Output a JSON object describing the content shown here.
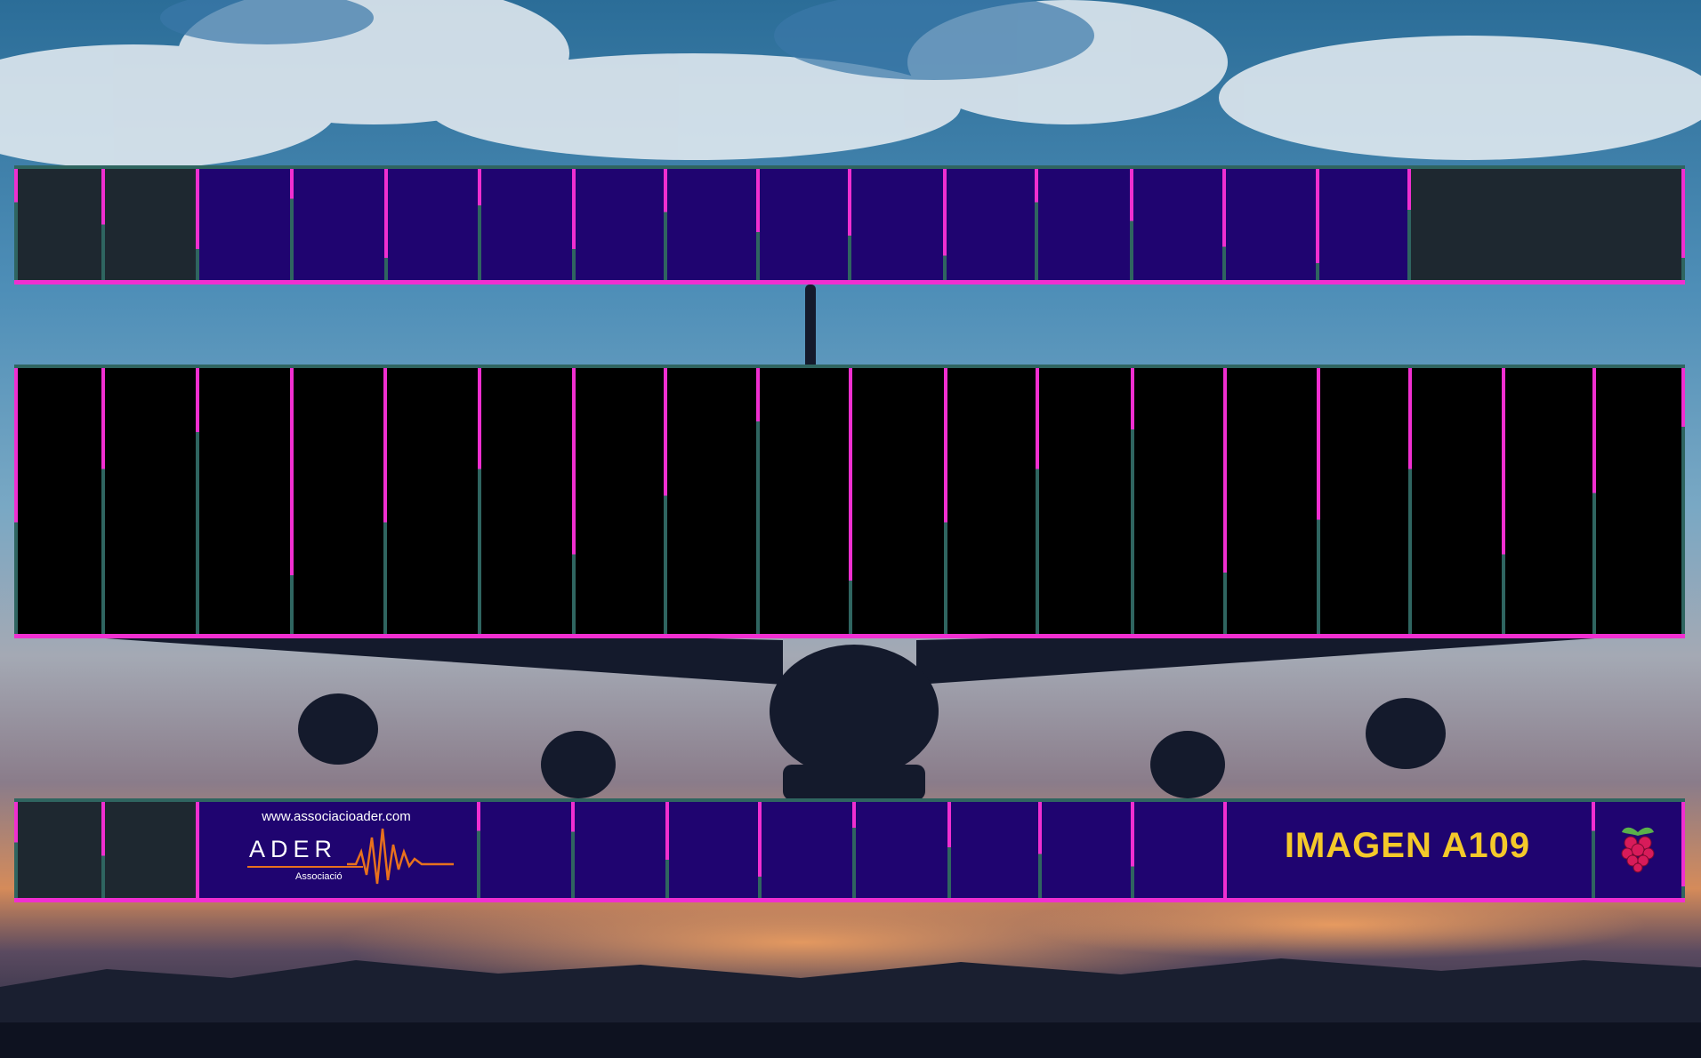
{
  "background": {
    "description_icon": "airplane-sunset-wallpaper-icon",
    "sky_top": "#2b6d98",
    "sky_bottom": "#e59a58"
  },
  "colors": {
    "frame_magenta": "#f02fd0",
    "frame_teal": "#2f6560",
    "cell_dark": "#1e2830",
    "cell_purple": "#1f0470",
    "cell_black": "#000000",
    "title_yellow": "#f4c92a",
    "logo_orange": "#e8711d"
  },
  "logo": {
    "url": "www.associacioader.com",
    "name": "ADER",
    "subtitle": "Associació",
    "icon": "soundwave-icon"
  },
  "title": {
    "text": "IMAGEN A109"
  },
  "raspberry": {
    "icon": "raspberry-pi-icon"
  }
}
